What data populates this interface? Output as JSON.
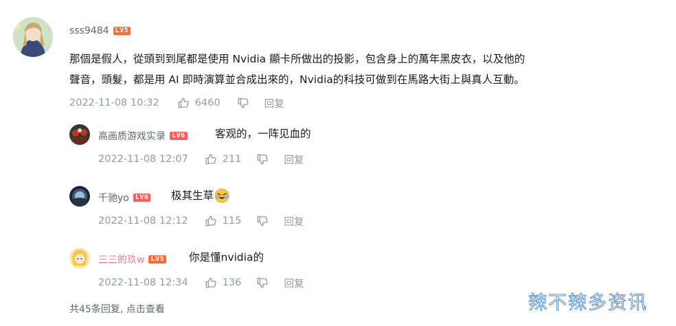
{
  "main_comment": {
    "username": "sss9484",
    "level": "LV5",
    "level_color": "#ff6b35",
    "content_line1": "那個是假人，從頭到到尾都是使用 Nvidia 顯卡所做出的投影，包含身上的萬年黑皮衣，以及他的",
    "content_line2": "聲音，頭髮，都是用 AI 即時演算並合成出來的，Nvidia的科技可做到在馬路大街上與真人互動。",
    "timestamp": "2022-11-08 10:32",
    "likes": "6460",
    "reply_label": "回复"
  },
  "replies": [
    {
      "username": "高画质游戏实录",
      "level": "LV6",
      "level_color": "#ff5c5c",
      "content": "客观的，一阵见血的",
      "timestamp": "2022-11-08 12:07",
      "likes": "211",
      "reply_label": "回复"
    },
    {
      "username": "千驰yo",
      "level": "LV6",
      "level_color": "#ff5c5c",
      "content": "极其生草",
      "emoji": "laughing-crying-emoji",
      "timestamp": "2022-11-08 12:12",
      "likes": "115",
      "reply_label": "回复"
    },
    {
      "username": "三三的玖w",
      "username_color": "#fb7299",
      "level": "LV5",
      "level_color": "#ff6b35",
      "content": "你是懂nvidia的",
      "timestamp": "2022-11-08 12:34",
      "likes": "136",
      "reply_label": "回复"
    }
  ],
  "more_replies": "共45条回复, 点击查看",
  "watermark": "辣不辣多资讯",
  "icons": {
    "like": "thumbs-up-icon",
    "dislike": "thumbs-down-icon"
  }
}
